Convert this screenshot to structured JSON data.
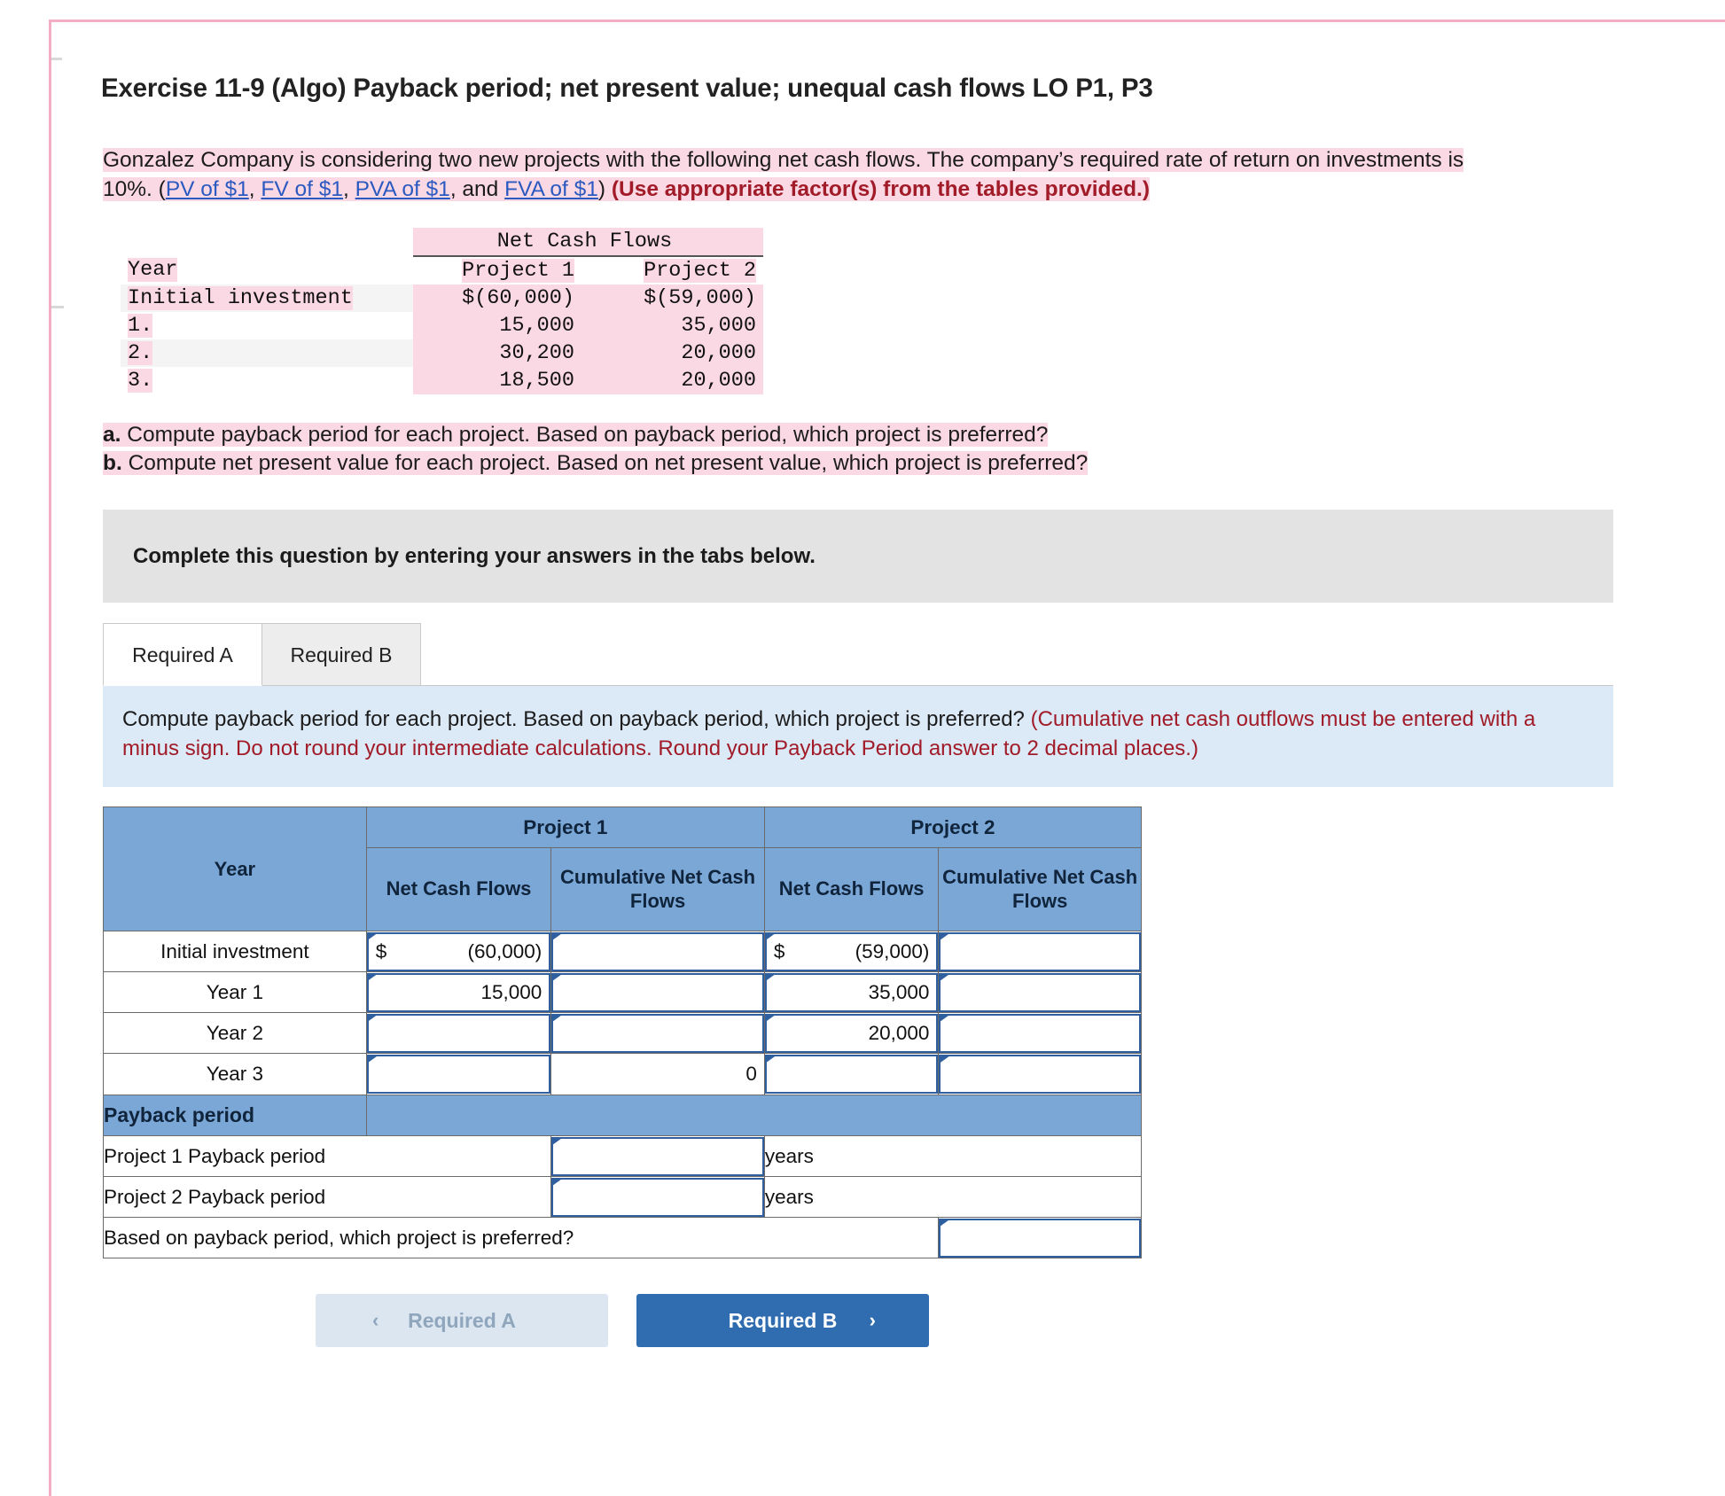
{
  "exercise": {
    "title": "Exercise 11-9 (Algo) Payback period; net present value; unequal cash flows LO P1, P3",
    "intro_part1": "Gonzalez Company is considering two new projects with the following net cash flows. The company’s required rate of return on investments is 10%. (",
    "link_pv": "PV of $1",
    "sep1": ", ",
    "link_fv": "FV of $1",
    "sep2": ", ",
    "link_pva": "PVA of $1",
    "sep3": ", and ",
    "link_fva": "FVA of $1",
    "intro_part2": ") ",
    "intro_bold_note": "(Use appropriate factor(s) from the tables provided.)"
  },
  "cash_flow_table": {
    "group_header": "Net Cash Flows",
    "col_year": "Year",
    "col_p1": "Project 1",
    "col_p2": "Project 2",
    "rows": [
      {
        "year": "Initial investment",
        "p1": "$(60,000)",
        "p2": "$(59,000)"
      },
      {
        "year": "1.",
        "p1": "15,000",
        "p2": "35,000"
      },
      {
        "year": "2.",
        "p1": "30,200",
        "p2": "20,000"
      },
      {
        "year": "3.",
        "p1": "18,500",
        "p2": "20,000"
      }
    ]
  },
  "requirements": {
    "a_label": "a.",
    "a_text": " Compute payback period for each project. Based on payback period, which project is preferred?",
    "b_label": "b.",
    "b_text": " Compute net present value for each project. Based on net present value, which project is preferred?"
  },
  "grey_bar": {
    "text": "Complete this question by entering your answers in the tabs below."
  },
  "tabs": [
    {
      "label": "Required A",
      "active": true
    },
    {
      "label": "Required B",
      "active": false
    }
  ],
  "instruction_panel": {
    "main": "Compute payback period for each project. Based on payback period, which project is preferred? ",
    "note": "(Cumulative net cash outflows must be entered with a minus sign. Do not round your intermediate calculations. Round your Payback Period answer to 2 decimal places.)"
  },
  "answer_table": {
    "group_p1": "Project 1",
    "group_p2": "Project 2",
    "col_year": "Year",
    "col_p1_ncf": "Net Cash Flows",
    "col_p1_cum": "Cumulative Net Cash Flows",
    "col_p2_ncf": "Net Cash Flows",
    "col_p2_cum": "Cumulative Net Cash Flows",
    "rows": [
      {
        "label": "Initial investment",
        "p1_ncf": "(60,000)",
        "p1_ncf_dollar": "$",
        "p1_ncf_input": true,
        "p1_cum": "",
        "p1_cum_input": true,
        "p2_ncf": "(59,000)",
        "p2_ncf_dollar": "$",
        "p2_ncf_input": true,
        "p2_cum": "",
        "p2_cum_input": true
      },
      {
        "label": "Year 1",
        "p1_ncf": "15,000",
        "p1_ncf_dollar": "",
        "p1_ncf_input": true,
        "p1_cum": "",
        "p1_cum_input": true,
        "p2_ncf": "35,000",
        "p2_ncf_dollar": "",
        "p2_ncf_input": true,
        "p2_cum": "",
        "p2_cum_input": true
      },
      {
        "label": "Year 2",
        "p1_ncf": "",
        "p1_ncf_dollar": "",
        "p1_ncf_input": true,
        "p1_cum": "",
        "p1_cum_input": true,
        "p2_ncf": "20,000",
        "p2_ncf_dollar": "",
        "p2_ncf_input": true,
        "p2_cum": "",
        "p2_cum_input": true
      },
      {
        "label": "Year 3",
        "p1_ncf": "",
        "p1_ncf_dollar": "",
        "p1_ncf_input": true,
        "p1_cum": "0",
        "p1_cum_input": false,
        "p2_ncf": "",
        "p2_ncf_dollar": "",
        "p2_ncf_input": true,
        "p2_cum": "",
        "p2_cum_input": true
      }
    ],
    "payback_header": "Payback period",
    "payback_rows": [
      {
        "label": "Project 1 Payback period",
        "value": "",
        "unit": "years"
      },
      {
        "label": "Project 2 Payback period",
        "value": "",
        "unit": "years"
      }
    ],
    "preferred_label": "Based on payback period, which project is preferred?",
    "preferred_value": ""
  },
  "nav": {
    "prev_label": "Required A",
    "prev_chevron": "‹",
    "next_label": "Required B",
    "next_chevron": "›"
  }
}
